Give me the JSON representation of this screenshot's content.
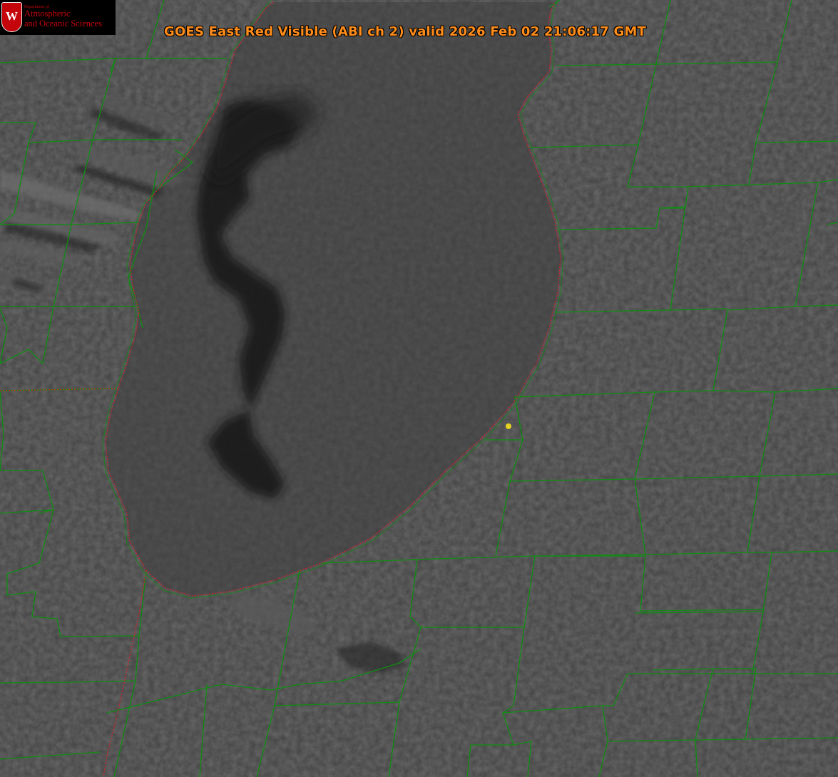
{
  "logo": {
    "department_text": "Department of",
    "line1": "Atmospheric",
    "line2": "and Oceanic Sciences",
    "seal_letter": "W"
  },
  "title": {
    "text": "GOES East Red Visible (ABI ch 2) valid 2026 Feb 02 21:06:17 GMT"
  },
  "colors": {
    "title": "#ff8c1a",
    "logo_text": "#c5050c",
    "seal": "#c5050c",
    "county_border": "#0f8f12",
    "state_border": "#d2202a",
    "lake": "#262626",
    "land_cloud": "#434343",
    "marker": "#e6d21f"
  },
  "map": {
    "product": "satellite-visible-imagery",
    "marker_icon": "yellow-dot-icon"
  }
}
